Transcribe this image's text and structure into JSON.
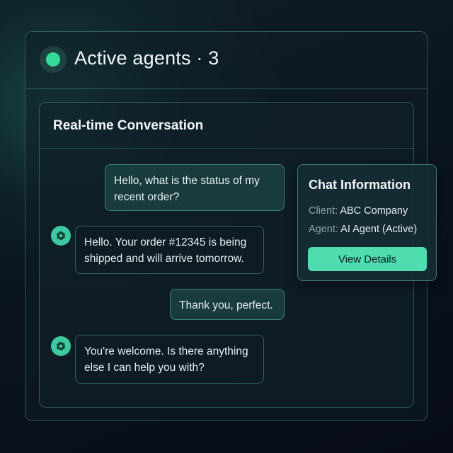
{
  "header": {
    "title": "Active agents · 3",
    "status_color": "#37d99a"
  },
  "conversation": {
    "title": "Real-time Conversation",
    "messages": [
      {
        "role": "user",
        "text_lines": [
          "Hello, what is the status of my",
          "recent order?"
        ]
      },
      {
        "role": "agent",
        "avatar_icon": "openai-logo-icon",
        "text_lines": [
          "Hello. Your order #12345 is being",
          "shipped and will arrive tomorrow."
        ]
      },
      {
        "role": "user",
        "text_lines": [
          "Thank you, perfect."
        ]
      },
      {
        "role": "agent",
        "avatar_icon": "openai-logo-icon",
        "text_lines": [
          "You're welcome. Is there anything",
          "else I can help you with?"
        ]
      }
    ]
  },
  "chat_info": {
    "title": "Chat Information",
    "client_label": "Client:",
    "client_value": "ABC Company",
    "agent_label": "Agent:",
    "agent_value": "AI Agent (Active)",
    "button_label": "View Details",
    "accent_color": "#4fdcae"
  }
}
